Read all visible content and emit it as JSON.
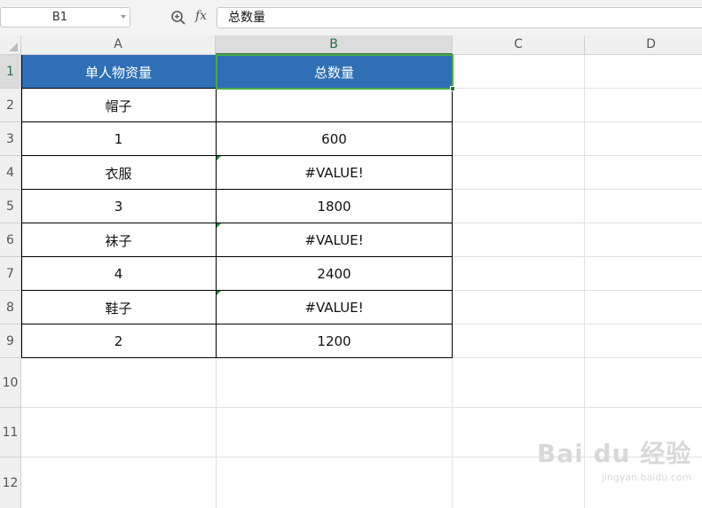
{
  "formula_bar": {
    "name_box": "B1",
    "fx_label": "fx",
    "formula_value": "总数量"
  },
  "columns": [
    {
      "label": "A",
      "selected": false
    },
    {
      "label": "B",
      "selected": true
    },
    {
      "label": "C",
      "selected": false
    },
    {
      "label": "D",
      "selected": false
    }
  ],
  "rows": [
    "1",
    "2",
    "3",
    "4",
    "5",
    "6",
    "7",
    "8",
    "9",
    "10",
    "11",
    "12"
  ],
  "table": {
    "header": [
      "单人物资量",
      "总数量"
    ],
    "body": [
      [
        "帽子",
        ""
      ],
      [
        "1",
        "600"
      ],
      [
        "衣服",
        "#VALUE!"
      ],
      [
        "3",
        "1800"
      ],
      [
        "袜子",
        "#VALUE!"
      ],
      [
        "4",
        "2400"
      ],
      [
        "鞋子",
        "#VALUE!"
      ],
      [
        "2",
        "1200"
      ]
    ],
    "header_color": "#2f6fb5",
    "error_indicator_color": "#1e8b3a"
  },
  "selection": {
    "cell": "B1",
    "color": "#4aa84a"
  },
  "watermark": {
    "main": "Bai du 经验",
    "sub": "jingyan.baidu.com"
  },
  "icons": {
    "zoom": "zoom-icon",
    "formula": "fx-icon"
  }
}
